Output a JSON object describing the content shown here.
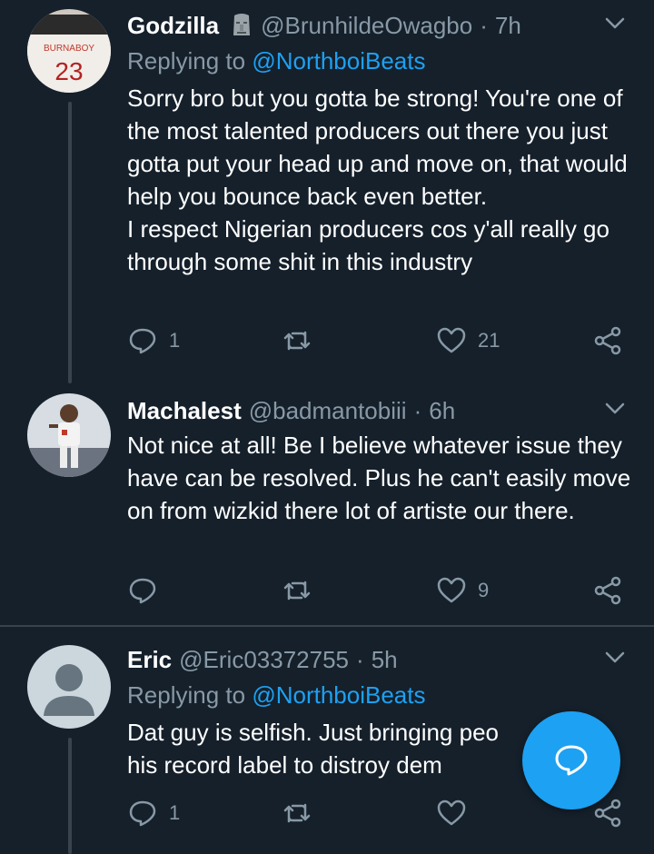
{
  "tweets": [
    {
      "name": "Godzilla",
      "handle": "@BrunhildeOwagbo",
      "separator": "·",
      "time": "7h",
      "replying_prefix": "Replying to",
      "replying_handle": "@NorthboiBeats",
      "avatar_jersey_number": "23",
      "avatar_jersey_text": "BURNABOY",
      "lines": [
        "Sorry bro but you gotta be strong! You're one of the most talented producers out there you just gotta put your head up and move on, that would help you bounce back even better.",
        "I respect Nigerian producers cos y'all really go through some shit in this industry"
      ],
      "reply_count": "1",
      "retweet_count": "",
      "like_count": "21"
    },
    {
      "name": "Machalest",
      "handle": "@badmantobiii",
      "separator": "·",
      "time": "6h",
      "lines": [
        "Not nice at all! Be I believe whatever issue they have can be  resolved. Plus he can't easily move on from wizkid there lot of artiste our there."
      ],
      "reply_count": "",
      "retweet_count": "",
      "like_count": "9"
    },
    {
      "name": "Eric",
      "handle": "@Eric03372755",
      "separator": "·",
      "time": "5h",
      "replying_prefix": "Replying to",
      "replying_handle": "@NorthboiBeats",
      "lines": [
        "Dat guy is selfish. Just bringing peo",
        "his record label to distroy dem"
      ],
      "reply_count": "1",
      "retweet_count": "",
      "like_count": ""
    }
  ],
  "colors": {
    "background": "#15202b",
    "secondary_text": "#8899a6",
    "link": "#1da1f2",
    "divider": "#38444d",
    "fab": "#1da1f2"
  },
  "icons": {
    "reply": "reply-icon",
    "retweet": "retweet-icon",
    "like": "heart-icon",
    "share": "share-icon",
    "caret": "chevron-down-icon",
    "fab": "compose-reply-icon",
    "name_badge": "moai-emoji-icon"
  }
}
